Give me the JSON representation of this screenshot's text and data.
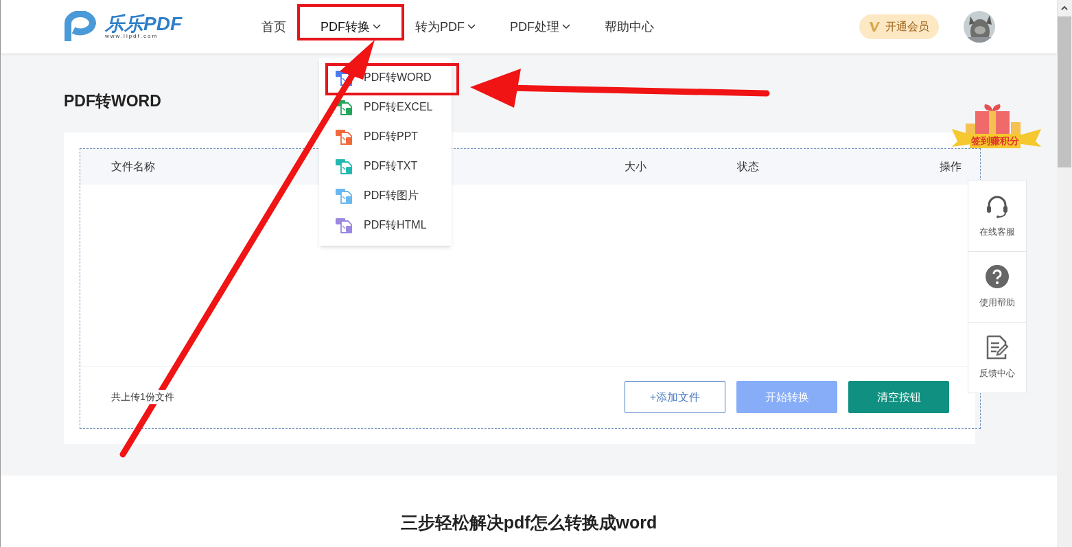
{
  "logo": {
    "name": "乐乐PDF",
    "url": "www.llpdf.com"
  },
  "nav": [
    {
      "label": "首页",
      "dropdown": false,
      "expanded": false
    },
    {
      "label": "PDF转换",
      "dropdown": true,
      "expanded": true
    },
    {
      "label": "转为PDF",
      "dropdown": true,
      "expanded": false
    },
    {
      "label": "PDF处理",
      "dropdown": true,
      "expanded": false
    },
    {
      "label": "帮助中心",
      "dropdown": false,
      "expanded": false
    }
  ],
  "dropdown_menu": [
    {
      "label": "PDF转WORD",
      "color": "#4a7cf0"
    },
    {
      "label": "PDF转EXCEL",
      "color": "#21a65a"
    },
    {
      "label": "PDF转PPT",
      "color": "#f06a3c"
    },
    {
      "label": "PDF转TXT",
      "color": "#21b8b0"
    },
    {
      "label": "PDF转图片",
      "color": "#6ab8f0"
    },
    {
      "label": "PDF转HTML",
      "color": "#9b86e0"
    }
  ],
  "vip_button": "开通会员",
  "page_title": "PDF转WORD",
  "table": {
    "columns": [
      "文件名称",
      "大小",
      "状态",
      "操作"
    ]
  },
  "upload_count": "共上传1份文件",
  "buttons": [
    {
      "label": "+添加文件",
      "kind": "outline"
    },
    {
      "label": "开始转换",
      "kind": "pale"
    },
    {
      "label": "清空按钮",
      "kind": "solid"
    }
  ],
  "signin_badge": "签到赚积分",
  "side_tools": [
    {
      "label": "在线客服",
      "kind": "headset"
    },
    {
      "label": "使用帮助",
      "kind": "help"
    },
    {
      "label": "反馈中心",
      "kind": "feedback"
    }
  ],
  "section_heading": "三步轻松解决pdf怎么转换成word"
}
